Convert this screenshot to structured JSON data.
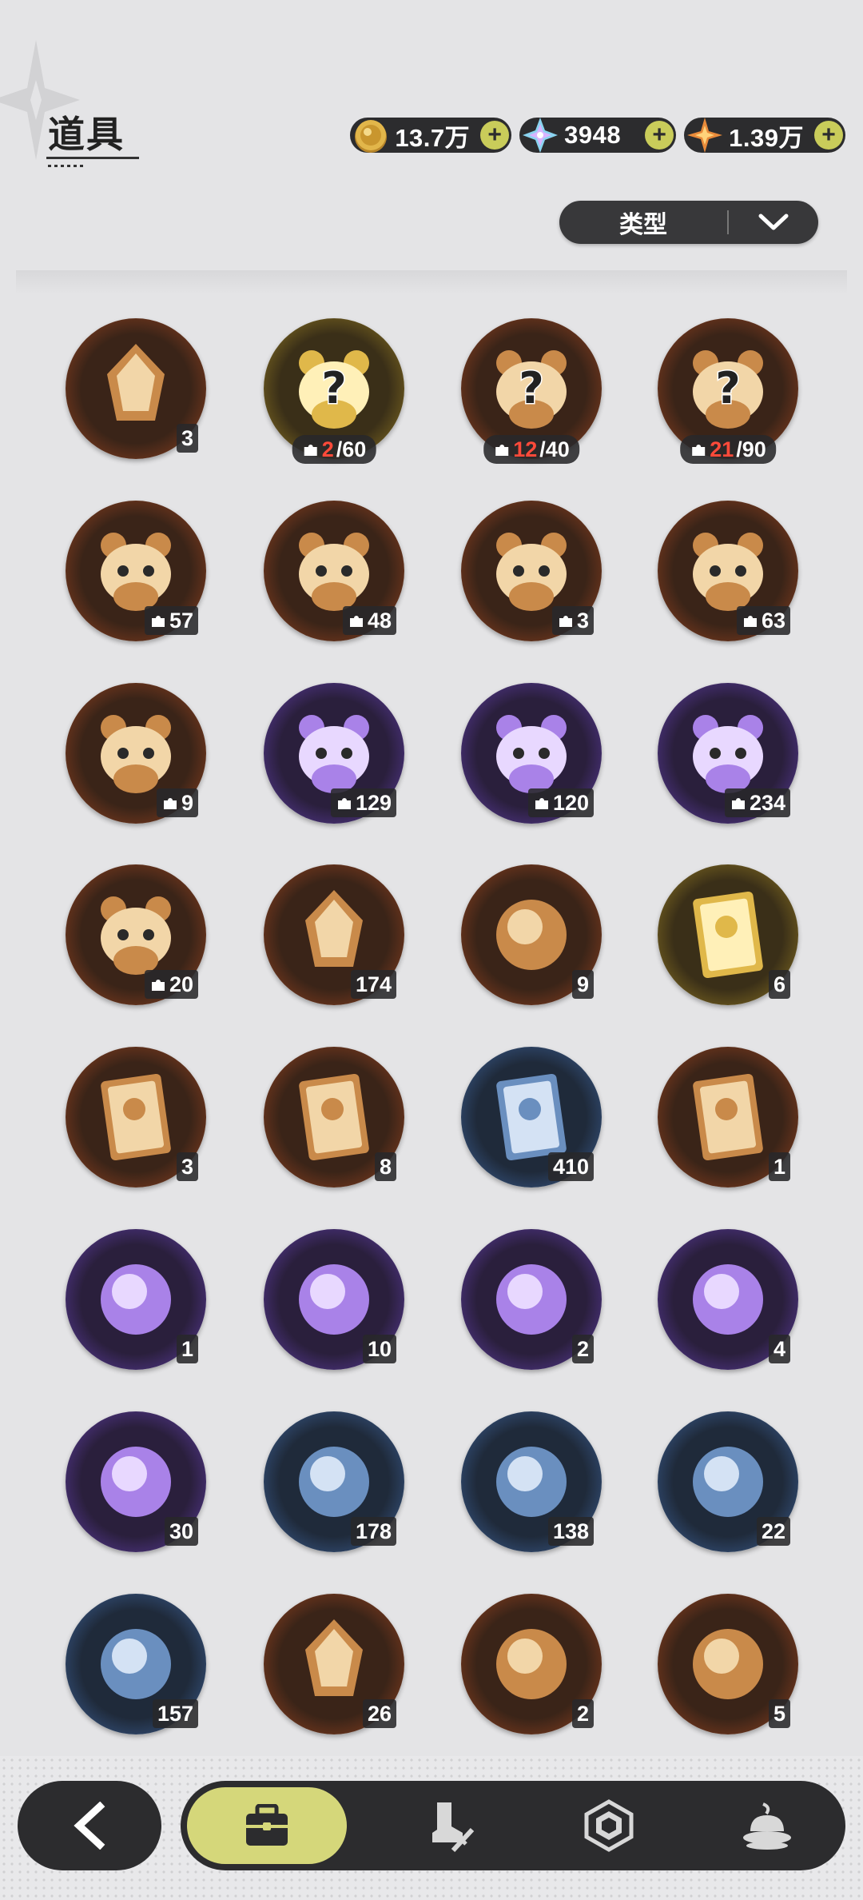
{
  "header": {
    "title": "道具",
    "currencies": [
      {
        "icon": "gold-coin-icon",
        "value": "13.7万",
        "plus": "+"
      },
      {
        "icon": "crystal-gem-icon",
        "value": "3948",
        "plus": "+"
      },
      {
        "icon": "orange-star-icon",
        "value": "1.39万",
        "plus": "+"
      }
    ],
    "filter": {
      "label": "类型",
      "icon": "chevron-down-icon"
    }
  },
  "items": [
    {
      "icon": "purple-crystal-shard-icon",
      "frame": "orange",
      "count": "3"
    },
    {
      "icon": "mystery-bear-gold-icon",
      "frame": "gold",
      "owned": "2",
      "need": "/60",
      "shard": true
    },
    {
      "icon": "mystery-bear-orange-icon",
      "frame": "orange",
      "owned": "12",
      "need": "/40",
      "shard": true
    },
    {
      "icon": "mystery-bear-brown-icon",
      "frame": "orange",
      "owned": "21",
      "need": "/90",
      "shard": true
    },
    {
      "icon": "bear-with-bell-icon",
      "frame": "orange",
      "count": "57",
      "shard": true
    },
    {
      "icon": "knight-helmet-bear-icon",
      "frame": "orange",
      "count": "48",
      "shard": true
    },
    {
      "icon": "white-cat-bear-icon",
      "frame": "orange",
      "count": "3",
      "shard": true
    },
    {
      "icon": "red-eye-bear-icon",
      "frame": "orange",
      "count": "63",
      "shard": true
    },
    {
      "icon": "purple-cat-bear-icon",
      "frame": "orange",
      "count": "9",
      "shard": true
    },
    {
      "icon": "green-eye-bear-icon",
      "frame": "purple",
      "count": "129",
      "shard": true
    },
    {
      "icon": "brown-bear-red-eye-icon",
      "frame": "purple",
      "count": "120",
      "shard": true
    },
    {
      "icon": "yellow-chick-bear-icon",
      "frame": "purple",
      "count": "234",
      "shard": true
    },
    {
      "icon": "tiger-bear-icon",
      "frame": "orange",
      "count": "20",
      "shard": true
    },
    {
      "icon": "star-crystal-icon",
      "frame": "orange",
      "count": "174"
    },
    {
      "icon": "paw-bell-icon",
      "frame": "orange",
      "count": "9"
    },
    {
      "icon": "gold-portrait-card-icon",
      "frame": "gold",
      "count": "6"
    },
    {
      "icon": "holo-portrait-card-icon",
      "frame": "orange",
      "count": "3"
    },
    {
      "icon": "orange-portrait-card-icon",
      "frame": "orange",
      "count": "8"
    },
    {
      "icon": "blue-portrait-card-icon",
      "frame": "blue",
      "count": "410"
    },
    {
      "icon": "silver-portrait-card-icon",
      "frame": "orange",
      "count": "1"
    },
    {
      "icon": "gift-box-icon",
      "frame": "purple",
      "count": "1"
    },
    {
      "icon": "gold-acorn-icon",
      "frame": "purple",
      "count": "10"
    },
    {
      "icon": "magic-mirror-icon",
      "frame": "purple",
      "count": "2"
    },
    {
      "icon": "scroll-icon",
      "frame": "purple",
      "count": "4"
    },
    {
      "icon": "peach-fruit-icon",
      "frame": "purple",
      "count": "30"
    },
    {
      "icon": "shovel-icon",
      "frame": "blue",
      "count": "178"
    },
    {
      "icon": "boxing-glove-icon",
      "frame": "blue",
      "count": "138"
    },
    {
      "icon": "pickaxe-icon",
      "frame": "blue",
      "count": "22"
    },
    {
      "icon": "hammer-icon",
      "frame": "blue",
      "count": "157"
    },
    {
      "icon": "pink-heart-gem-icon",
      "frame": "orange",
      "count": "26"
    },
    {
      "icon": "tshirt-token-icon",
      "frame": "orange",
      "count": "2"
    },
    {
      "icon": "rainbow-ticket-icon",
      "frame": "orange",
      "count": "5"
    }
  ],
  "nav": {
    "back": "back-arrow-icon",
    "tabs": [
      {
        "icon": "bag-icon",
        "active": true
      },
      {
        "icon": "boot-sword-icon",
        "active": false
      },
      {
        "icon": "hexagon-gem-icon",
        "active": false
      },
      {
        "icon": "pudding-icon",
        "active": false
      }
    ]
  },
  "colors": {
    "background": "#e4e4e6",
    "dark": "#2c2c2e",
    "accent": "#d5d77a",
    "badge_red": "#ff4a3a"
  }
}
